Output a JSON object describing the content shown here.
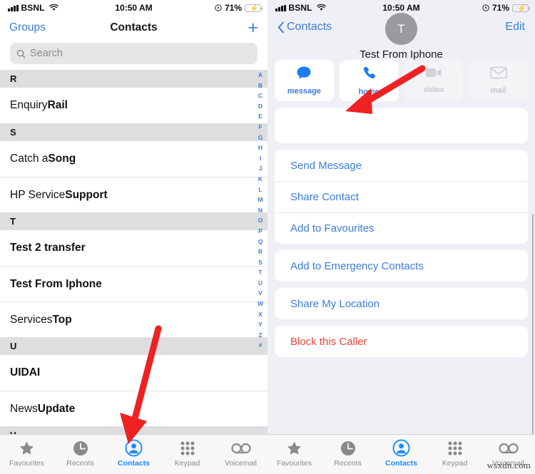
{
  "status_bar": {
    "carrier": "BSNL",
    "time": "10:50 AM",
    "battery_percent": "71%",
    "signal_icon": "cellular-bars-icon",
    "wifi_icon": "wifi-icon",
    "location_icon": "location-arrow-icon",
    "battery_icon": "battery-charging-icon"
  },
  "left": {
    "nav": {
      "groups_label": "Groups",
      "title": "Contacts",
      "add_label": "+",
      "add_icon": "plus-icon"
    },
    "search": {
      "placeholder": "Search",
      "icon": "search-icon"
    },
    "list": [
      {
        "type": "section",
        "label": "R"
      },
      {
        "type": "contact",
        "first": "Enquiry ",
        "last": "Rail"
      },
      {
        "type": "section",
        "label": "S"
      },
      {
        "type": "contact",
        "first": "Catch a ",
        "last": "Song"
      },
      {
        "type": "contact",
        "first": "HP Service ",
        "last": "Support"
      },
      {
        "type": "section",
        "label": "T"
      },
      {
        "type": "contact",
        "first": "",
        "last": "Test 2 transfer"
      },
      {
        "type": "contact",
        "first": "",
        "last": "Test From Iphone"
      },
      {
        "type": "contact",
        "first": "Services ",
        "last": "Top"
      },
      {
        "type": "section",
        "label": "U"
      },
      {
        "type": "contact",
        "first": "",
        "last": "UIDAI"
      },
      {
        "type": "contact",
        "first": "News ",
        "last": "Update"
      },
      {
        "type": "section",
        "label": "V"
      }
    ],
    "alphabet_index": [
      "A",
      "B",
      "C",
      "D",
      "E",
      "F",
      "G",
      "H",
      "I",
      "J",
      "K",
      "L",
      "M",
      "N",
      "O",
      "P",
      "Q",
      "R",
      "S",
      "T",
      "U",
      "V",
      "W",
      "X",
      "Y",
      "Z",
      "#"
    ]
  },
  "right": {
    "nav": {
      "back_label": "Contacts",
      "back_icon": "chevron-left-icon",
      "edit_label": "Edit"
    },
    "contact": {
      "name": "Test From Iphone",
      "avatar_initial": "T"
    },
    "quick_actions": [
      {
        "label": "message",
        "icon": "message-bubble-icon",
        "enabled": true
      },
      {
        "label": "home",
        "icon": "phone-handset-icon",
        "enabled": true
      },
      {
        "label": "video",
        "icon": "video-camera-icon",
        "enabled": false
      },
      {
        "label": "mail",
        "icon": "envelope-icon",
        "enabled": false
      }
    ],
    "action_groups": [
      {
        "items": [
          {
            "label": "Send Message",
            "style": "link"
          },
          {
            "label": "Share Contact",
            "style": "link"
          },
          {
            "label": "Add to Favourites",
            "style": "link"
          }
        ]
      },
      {
        "items": [
          {
            "label": "Add to Emergency Contacts",
            "style": "link"
          }
        ]
      },
      {
        "items": [
          {
            "label": "Share My Location",
            "style": "link"
          }
        ]
      },
      {
        "items": [
          {
            "label": "Block this Caller",
            "style": "danger"
          }
        ]
      }
    ]
  },
  "tabs": [
    {
      "label": "Favourites",
      "icon": "star-icon",
      "active": false
    },
    {
      "label": "Recents",
      "icon": "clock-icon",
      "active": false
    },
    {
      "label": "Contacts",
      "icon": "person-circle-icon",
      "active": true
    },
    {
      "label": "Keypad",
      "icon": "keypad-dots-icon",
      "active": false
    },
    {
      "label": "Voicemail",
      "icon": "voicemail-icon",
      "active": false
    }
  ],
  "annotations": {
    "left_arrow_target": "Contacts tab",
    "right_arrow_target": "Block this Caller",
    "watermark": "wsxdn.com"
  },
  "colors": {
    "accent_blue": "#3b7dd8",
    "tab_active_blue": "#1a8cff",
    "danger_red": "#e8453c",
    "annotation_red": "#ee2222",
    "panel_bg": "#eff0f5",
    "section_header_bg": "#dedee0"
  }
}
